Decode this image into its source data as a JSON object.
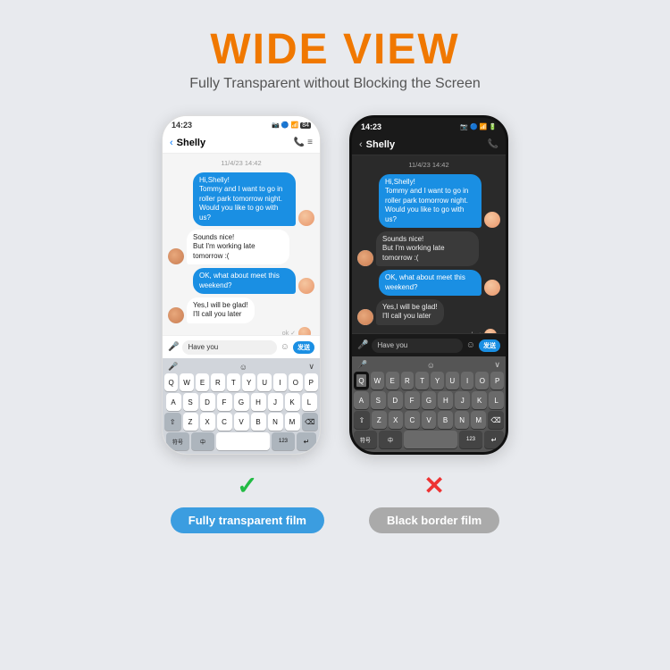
{
  "header": {
    "title": "WIDE VIEW",
    "subtitle": "Fully Transparent without Blocking the Screen"
  },
  "phones": [
    {
      "id": "phone-transparent",
      "type": "white",
      "statusTime": "14:23",
      "statusIcons": "🔋 ✦ 📶",
      "contactName": "Shelly",
      "dateLabel": "11/4/23 14:42",
      "messages": [
        {
          "type": "sent",
          "text": "Hi,Shelly!\nTommy and I want to go in roller park tomorrow night. Would you like to go with us?"
        },
        {
          "type": "received",
          "text": "Sounds nice!\nBut I'm working late tomorrow :("
        },
        {
          "type": "sent",
          "text": "OK, what about meet this weekend?"
        },
        {
          "type": "received",
          "text": "Yes,I will be glad!\nI'll call you later"
        }
      ],
      "inputPlaceholder": "Have you",
      "sendLabel": "发送"
    },
    {
      "id": "phone-black-border",
      "type": "black",
      "statusTime": "14:23",
      "contactName": "Shelly",
      "dateLabel": "11/4/23 14:42",
      "messages": [
        {
          "type": "sent",
          "text": "Hi,Shelly!\nTommy and I want to go in roller park tomorrow night. Would you like to go with us?"
        },
        {
          "type": "received",
          "text": "Sounds nice!\nBut I'm working late tomorrow :("
        },
        {
          "type": "sent",
          "text": "OK, what about meet this weekend?"
        },
        {
          "type": "received",
          "text": "Yes,I will be glad!\nI'll call you later"
        }
      ],
      "inputPlaceholder": "Have you",
      "sendLabel": "发送"
    }
  ],
  "labels": [
    {
      "icon": "✓",
      "iconColor": "green",
      "text": "Fully transparent film",
      "pillColor": "blue"
    },
    {
      "icon": "✕",
      "iconColor": "red",
      "text": "Black border film",
      "pillColor": "gray"
    }
  ],
  "keyboard": {
    "rows": [
      [
        "Q",
        "W",
        "E",
        "R",
        "T",
        "Y",
        "U",
        "I",
        "O",
        "P"
      ],
      [
        "A",
        "S",
        "D",
        "F",
        "G",
        "H",
        "J",
        "K",
        "L"
      ],
      [
        "Z",
        "X",
        "C",
        "V",
        "B",
        "N",
        "M"
      ]
    ],
    "bottomLeft": "符号",
    "bottomMid1": "中",
    "bottomSpace": "",
    "bottomNum": "123",
    "bottomReturn": "↵"
  }
}
